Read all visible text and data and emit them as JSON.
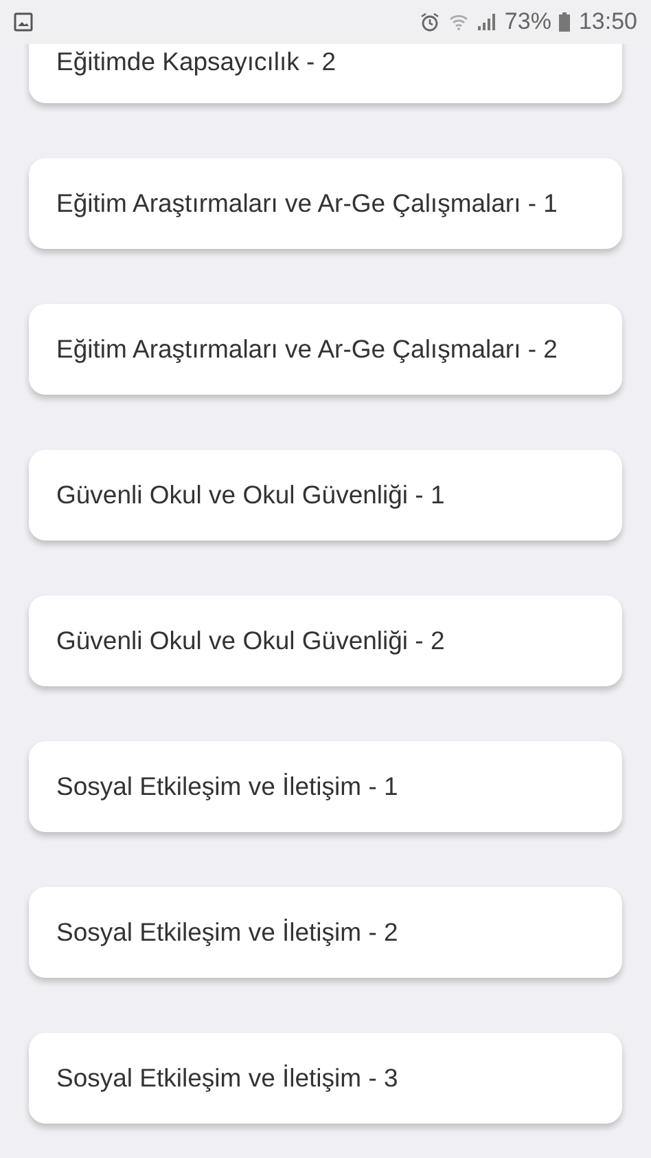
{
  "status_bar": {
    "battery_percent": "73%",
    "time": "13:50"
  },
  "items": [
    {
      "label": "Eğitimde Kapsayıcılık - 2"
    },
    {
      "label": "Eğitim Araştırmaları ve Ar-Ge Çalışmaları - 1"
    },
    {
      "label": "Eğitim Araştırmaları ve Ar-Ge Çalışmaları - 2"
    },
    {
      "label": "Güvenli Okul ve Okul Güvenliği - 1"
    },
    {
      "label": "Güvenli Okul ve Okul Güvenliği - 2"
    },
    {
      "label": "Sosyal Etkileşim ve İletişim - 1"
    },
    {
      "label": "Sosyal Etkileşim ve İletişim - 2"
    },
    {
      "label": "Sosyal Etkileşim ve İletişim - 3"
    }
  ]
}
